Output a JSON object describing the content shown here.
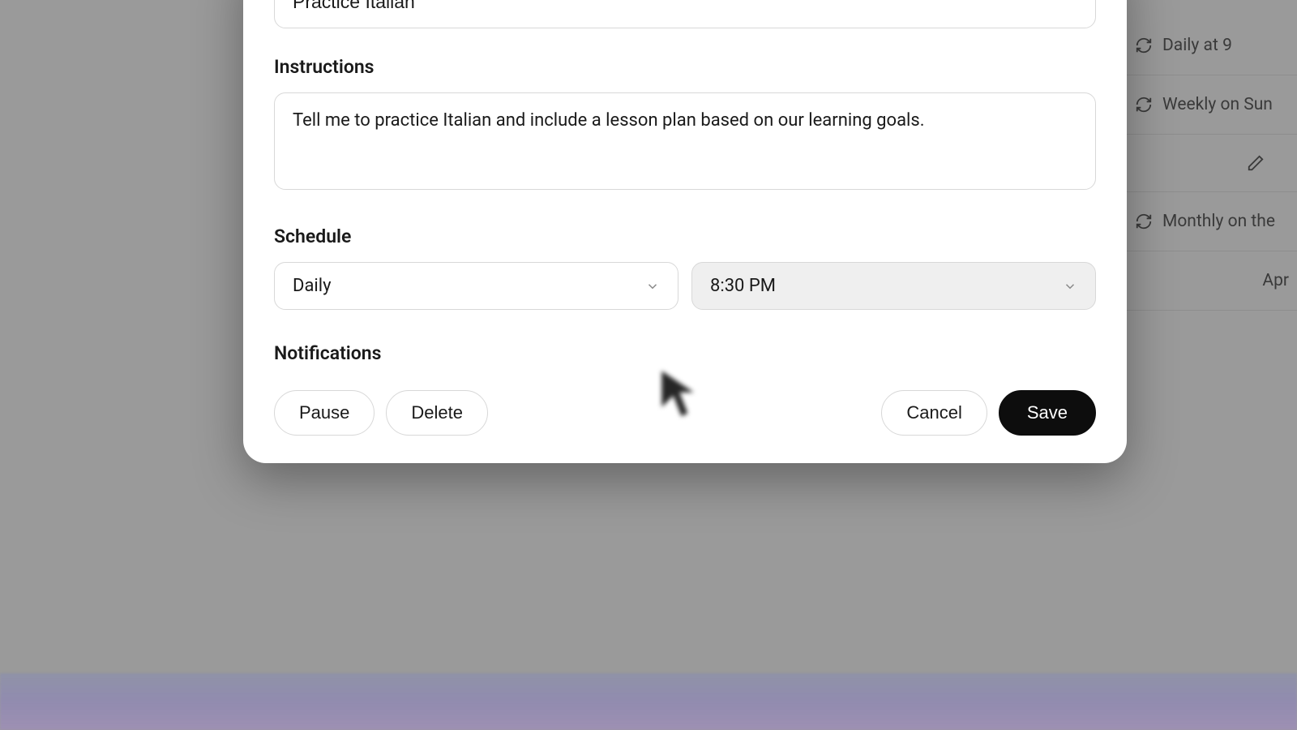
{
  "task": {
    "name": "Practice Italian",
    "instructions_label": "Instructions",
    "instructions": "Tell me to practice Italian and include a lesson plan based on our learning goals.",
    "schedule_label": "Schedule",
    "frequency": "Daily",
    "time": "8:30 PM",
    "notifications_label": "Notifications"
  },
  "buttons": {
    "pause": "Pause",
    "delete": "Delete",
    "cancel": "Cancel",
    "save": "Save"
  },
  "background_items": [
    {
      "icon": "refresh",
      "label": "Daily at 9"
    },
    {
      "icon": "refresh",
      "label": "Weekly on Sun"
    },
    {
      "icon": "pencil",
      "label": ""
    },
    {
      "icon": "refresh",
      "label": "Monthly on the"
    },
    {
      "icon": "",
      "label": "Apr"
    }
  ]
}
